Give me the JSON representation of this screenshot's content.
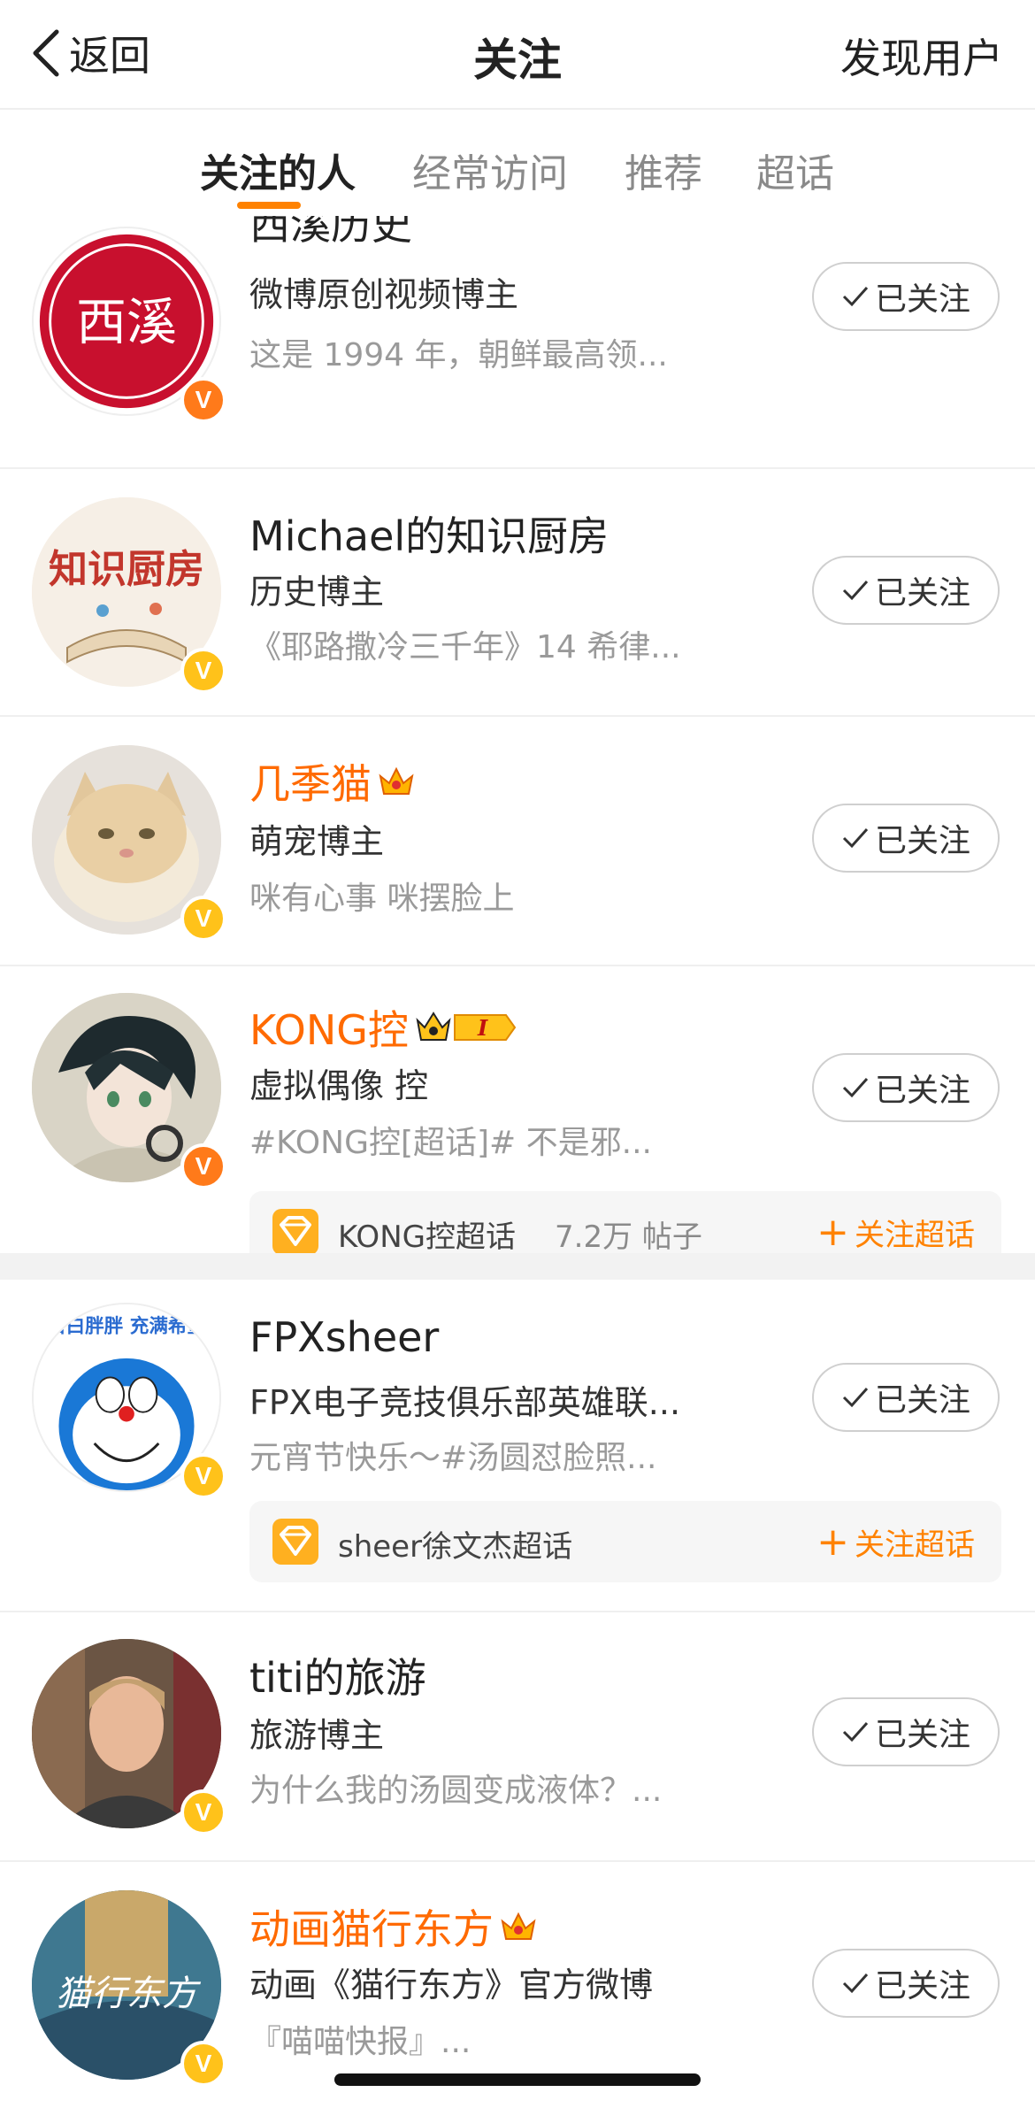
{
  "header": {
    "back_label": "返回",
    "title": "关注",
    "right_action": "发现用户"
  },
  "tabs": [
    {
      "label": "关注的人",
      "active": true
    },
    {
      "label": "经常访问",
      "active": false
    },
    {
      "label": "推荐",
      "active": false
    },
    {
      "label": "超话",
      "active": false
    }
  ],
  "follow_button_label": "已关注",
  "supertopic_follow_label": "关注超话",
  "users": [
    {
      "name": "西溪历史",
      "desc": "微博原创视频博主",
      "snippet": "这是 1994 年，朝鲜最高领...",
      "badge": "orange",
      "avatar_text": "西溪"
    },
    {
      "name": "Michael的知识厨房",
      "desc": "历史博主",
      "snippet": "《耶路撒冷三千年》14 希律...",
      "badge": "yellow",
      "avatar_text": "知识厨房"
    },
    {
      "name": "几季猫",
      "desc": "萌宠博主",
      "snippet": "咪有心事 咪摆脸上",
      "badge": "yellow",
      "vip": true
    },
    {
      "name": "KONG控",
      "desc": "虚拟偶像 控",
      "snippet": "#KONG控[超话]#  不是邪...",
      "badge": "orange",
      "vip": true,
      "supertopic": {
        "name": "KONG控超话",
        "count": "7.2万 帖子"
      }
    },
    {
      "name": "FPXsheer",
      "desc": "FPX电子竞技俱乐部英雄联...",
      "snippet": "元宵节快乐～#汤圆怼脸照...",
      "badge": "yellow",
      "avatar_text": "白白胖胖 充满希望",
      "supertopic": {
        "name": "sheer徐文杰超话"
      }
    },
    {
      "name": "titi的旅游",
      "desc": "旅游博主",
      "snippet": "为什么我的汤圆变成液体？...",
      "badge": "yellow"
    },
    {
      "name": "动画猫行东方",
      "desc": "动画《猫行东方》官方微博",
      "snippet": "『喵喵快报』...",
      "badge": "yellow",
      "vip": true,
      "avatar_text": "猫行东方"
    }
  ],
  "colors": {
    "accent": "#ff8200",
    "vip_name": "#ff6a00",
    "badge_orange": "#ff7a1a",
    "badge_yellow": "#ffc21a"
  }
}
